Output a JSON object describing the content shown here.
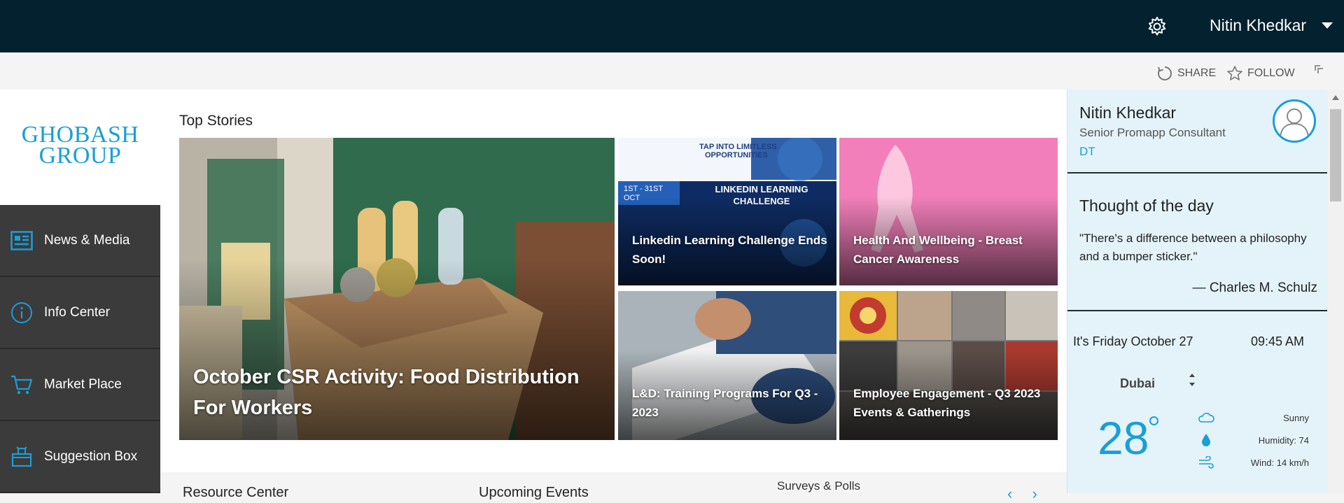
{
  "header": {
    "user_name": "Nitin Khedkar",
    "icons": [
      "gear-icon",
      "chevron-down-icon"
    ]
  },
  "actions": {
    "share_label": "SHARE",
    "follow_label": "FOLLOW"
  },
  "logo": {
    "line1": "GHOBASH",
    "line2": "GROUP"
  },
  "nav": {
    "items": [
      {
        "label": "News & Media",
        "icon": "newspaper-icon"
      },
      {
        "label": "Info Center",
        "icon": "info-icon"
      },
      {
        "label": "Market Place",
        "icon": "cart-icon"
      },
      {
        "label": "Suggestion Box",
        "icon": "suggestion-box-icon"
      }
    ]
  },
  "top_stories": {
    "title": "Top Stories",
    "stories": [
      {
        "title": "October CSR Activity: Food Distribution For Workers"
      },
      {
        "title": "Linkedin Learning Challenge Ends Soon!",
        "banner_line1": "TAP INTO LIMITLESS",
        "banner_line2": "OPPORTUNITIES",
        "banner_dates": "1ST - 31ST OCT",
        "banner_heading": "LINKEDIN LEARNING CHALLENGE"
      },
      {
        "title": "Health And Wellbeing - Breast Cancer Awareness"
      },
      {
        "title": "L&D: Training Programs For Q3 - 2023"
      },
      {
        "title": "Employee Engagement - Q3 2023 Events & Gatherings"
      }
    ]
  },
  "lower_sections": {
    "resource_center": "Resource Center",
    "upcoming_events": "Upcoming Events",
    "surveys": "Surveys & Polls"
  },
  "profile": {
    "name": "Nitin Khedkar",
    "role": "Senior Promapp Consultant",
    "department": "DT"
  },
  "thought": {
    "title": "Thought of the day",
    "quote": "\"There's a difference between a philosophy and a bumper sticker.\"",
    "author": "— Charles M. Schulz"
  },
  "weather": {
    "date_text": "It's Friday October 27",
    "time_text": "09:45 AM",
    "city": "Dubai",
    "temperature": "28",
    "condition": "Sunny",
    "humidity": "Humidity: 74",
    "wind": "Wind: 14 km/h",
    "accent": "#1a9ed8"
  },
  "colors": {
    "topbar": "#03212f",
    "nav_bg": "#3b3b3b",
    "accent": "#1a9ed8",
    "right_panel": "#e4f3fa"
  }
}
